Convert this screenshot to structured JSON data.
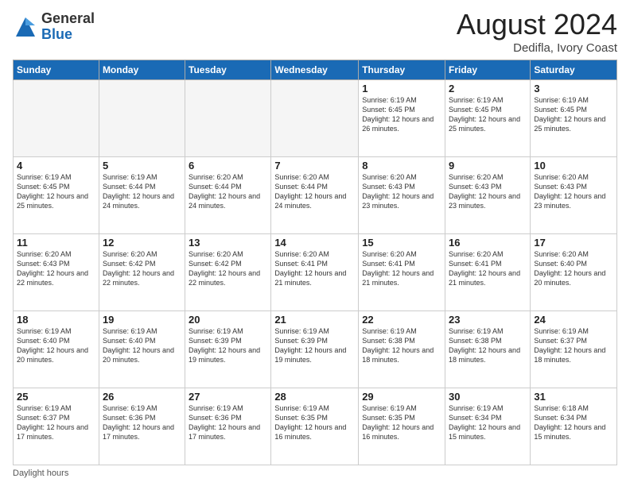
{
  "logo": {
    "general": "General",
    "blue": "Blue"
  },
  "header": {
    "month": "August 2024",
    "location": "Dedifla, Ivory Coast"
  },
  "days_of_week": [
    "Sunday",
    "Monday",
    "Tuesday",
    "Wednesday",
    "Thursday",
    "Friday",
    "Saturday"
  ],
  "weeks": [
    [
      {
        "day": "",
        "info": ""
      },
      {
        "day": "",
        "info": ""
      },
      {
        "day": "",
        "info": ""
      },
      {
        "day": "",
        "info": ""
      },
      {
        "day": "1",
        "info": "Sunrise: 6:19 AM\nSunset: 6:45 PM\nDaylight: 12 hours\nand 26 minutes."
      },
      {
        "day": "2",
        "info": "Sunrise: 6:19 AM\nSunset: 6:45 PM\nDaylight: 12 hours\nand 25 minutes."
      },
      {
        "day": "3",
        "info": "Sunrise: 6:19 AM\nSunset: 6:45 PM\nDaylight: 12 hours\nand 25 minutes."
      }
    ],
    [
      {
        "day": "4",
        "info": "Sunrise: 6:19 AM\nSunset: 6:45 PM\nDaylight: 12 hours\nand 25 minutes."
      },
      {
        "day": "5",
        "info": "Sunrise: 6:19 AM\nSunset: 6:44 PM\nDaylight: 12 hours\nand 24 minutes."
      },
      {
        "day": "6",
        "info": "Sunrise: 6:20 AM\nSunset: 6:44 PM\nDaylight: 12 hours\nand 24 minutes."
      },
      {
        "day": "7",
        "info": "Sunrise: 6:20 AM\nSunset: 6:44 PM\nDaylight: 12 hours\nand 24 minutes."
      },
      {
        "day": "8",
        "info": "Sunrise: 6:20 AM\nSunset: 6:43 PM\nDaylight: 12 hours\nand 23 minutes."
      },
      {
        "day": "9",
        "info": "Sunrise: 6:20 AM\nSunset: 6:43 PM\nDaylight: 12 hours\nand 23 minutes."
      },
      {
        "day": "10",
        "info": "Sunrise: 6:20 AM\nSunset: 6:43 PM\nDaylight: 12 hours\nand 23 minutes."
      }
    ],
    [
      {
        "day": "11",
        "info": "Sunrise: 6:20 AM\nSunset: 6:43 PM\nDaylight: 12 hours\nand 22 minutes."
      },
      {
        "day": "12",
        "info": "Sunrise: 6:20 AM\nSunset: 6:42 PM\nDaylight: 12 hours\nand 22 minutes."
      },
      {
        "day": "13",
        "info": "Sunrise: 6:20 AM\nSunset: 6:42 PM\nDaylight: 12 hours\nand 22 minutes."
      },
      {
        "day": "14",
        "info": "Sunrise: 6:20 AM\nSunset: 6:41 PM\nDaylight: 12 hours\nand 21 minutes."
      },
      {
        "day": "15",
        "info": "Sunrise: 6:20 AM\nSunset: 6:41 PM\nDaylight: 12 hours\nand 21 minutes."
      },
      {
        "day": "16",
        "info": "Sunrise: 6:20 AM\nSunset: 6:41 PM\nDaylight: 12 hours\nand 21 minutes."
      },
      {
        "day": "17",
        "info": "Sunrise: 6:20 AM\nSunset: 6:40 PM\nDaylight: 12 hours\nand 20 minutes."
      }
    ],
    [
      {
        "day": "18",
        "info": "Sunrise: 6:19 AM\nSunset: 6:40 PM\nDaylight: 12 hours\nand 20 minutes."
      },
      {
        "day": "19",
        "info": "Sunrise: 6:19 AM\nSunset: 6:40 PM\nDaylight: 12 hours\nand 20 minutes."
      },
      {
        "day": "20",
        "info": "Sunrise: 6:19 AM\nSunset: 6:39 PM\nDaylight: 12 hours\nand 19 minutes."
      },
      {
        "day": "21",
        "info": "Sunrise: 6:19 AM\nSunset: 6:39 PM\nDaylight: 12 hours\nand 19 minutes."
      },
      {
        "day": "22",
        "info": "Sunrise: 6:19 AM\nSunset: 6:38 PM\nDaylight: 12 hours\nand 18 minutes."
      },
      {
        "day": "23",
        "info": "Sunrise: 6:19 AM\nSunset: 6:38 PM\nDaylight: 12 hours\nand 18 minutes."
      },
      {
        "day": "24",
        "info": "Sunrise: 6:19 AM\nSunset: 6:37 PM\nDaylight: 12 hours\nand 18 minutes."
      }
    ],
    [
      {
        "day": "25",
        "info": "Sunrise: 6:19 AM\nSunset: 6:37 PM\nDaylight: 12 hours\nand 17 minutes."
      },
      {
        "day": "26",
        "info": "Sunrise: 6:19 AM\nSunset: 6:36 PM\nDaylight: 12 hours\nand 17 minutes."
      },
      {
        "day": "27",
        "info": "Sunrise: 6:19 AM\nSunset: 6:36 PM\nDaylight: 12 hours\nand 17 minutes."
      },
      {
        "day": "28",
        "info": "Sunrise: 6:19 AM\nSunset: 6:35 PM\nDaylight: 12 hours\nand 16 minutes."
      },
      {
        "day": "29",
        "info": "Sunrise: 6:19 AM\nSunset: 6:35 PM\nDaylight: 12 hours\nand 16 minutes."
      },
      {
        "day": "30",
        "info": "Sunrise: 6:19 AM\nSunset: 6:34 PM\nDaylight: 12 hours\nand 15 minutes."
      },
      {
        "day": "31",
        "info": "Sunrise: 6:18 AM\nSunset: 6:34 PM\nDaylight: 12 hours\nand 15 minutes."
      }
    ]
  ],
  "footer": {
    "note": "Daylight hours"
  }
}
